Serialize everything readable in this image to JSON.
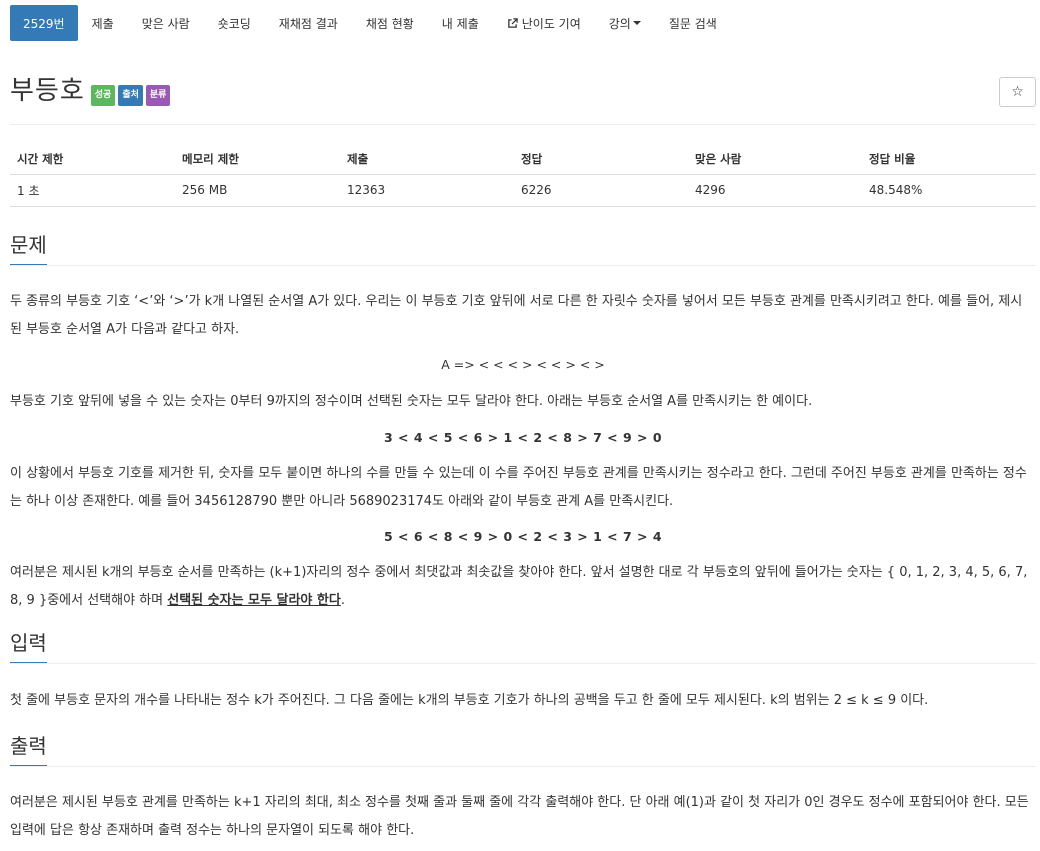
{
  "nav": {
    "items": [
      {
        "label": "2529번",
        "active": true
      },
      {
        "label": "제출"
      },
      {
        "label": "맞은 사람"
      },
      {
        "label": "숏코딩"
      },
      {
        "label": "재채점 결과"
      },
      {
        "label": "채점 현황"
      },
      {
        "label": "내 제출"
      },
      {
        "label": "난이도 기여",
        "icon": "external-link-icon"
      },
      {
        "label": "강의",
        "icon": "caret-down-icon"
      },
      {
        "label": "질문 검색"
      }
    ]
  },
  "problem": {
    "title": "부등호",
    "labels": [
      {
        "text": "성공",
        "color": "#5cb85c"
      },
      {
        "text": "출처",
        "color": "#337ab7"
      },
      {
        "text": "분류",
        "color": "#9b59b6"
      }
    ],
    "star_icon": "star-icon",
    "star_glyph": "☆"
  },
  "info": {
    "headers": [
      "시간 제한",
      "메모리 제한",
      "제출",
      "정답",
      "맞은 사람",
      "정답 비율"
    ],
    "values": [
      "1 초",
      "256 MB",
      "12363",
      "6226",
      "4296",
      "48.548%"
    ]
  },
  "sections": {
    "problem_title": "문제",
    "input_title": "입력",
    "output_title": "출력"
  },
  "body": {
    "p1": "두 종류의 부등호 기호 ‘<’와 ‘>’가 k개 나열된 순서열  A가 있다. 우리는 이 부등호 기호 앞뒤에 서로 다른 한 자릿수 숫자를 넣어서 모든 부등호 관계를 만족시키려고 한다. 예를 들어, 제시된 부등호 순서열 A가 다음과 같다고 하자.",
    "seq": "A =>  < < < > < < > < >",
    "p2": "부등호 기호 앞뒤에 넣을 수 있는 숫자는 0부터 9까지의 정수이며 선택된 숫자는 모두 달라야 한다. 아래는 부등호 순서열 A를 만족시키는 한 예이다.",
    "ex1": "3 < 4 < 5 < 6 > 1 < 2 < 8 > 7 < 9 > 0",
    "p3": "이 상황에서 부등호 기호를 제거한 뒤, 숫자를 모두 붙이면 하나의 수를 만들 수 있는데 이 수를 주어진 부등호 관계를 만족시키는 정수라고 한다. 그런데 주어진 부등호 관계를 만족하는 정수는 하나 이상 존재한다. 예를 들어 3456128790 뿐만 아니라 5689023174도 아래와 같이 부등호 관계 A를 만족시킨다.",
    "ex2": "5 < 6 < 8 < 9 > 0 < 2 < 3 > 1 < 7 > 4",
    "p4_a": "여러분은 제시된 k개의 부등호 순서를 만족하는 (k+1)자리의 정수 중에서 최댓값과 최솟값을 찾아야 한다. 앞서 설명한 대로 각 부등호의 앞뒤에 들어가는 숫자는 { 0, 1, 2, 3, 4, 5, 6, 7, 8, 9 }중에서 선택해야 하며 ",
    "p4_emph": "선택된 숫자는 모두 달라야 한다",
    "p4_b": ".",
    "input": "첫 줄에 부등호 문자의 개수를 나타내는 정수 k가 주어진다. 그 다음 줄에는 k개의 부등호 기호가 하나의 공백을 두고 한 줄에 모두 제시된다. k의 범위는 2 ≤ k ≤ 9 이다.",
    "output": "여러분은 제시된 부등호 관계를 만족하는 k+1 자리의 최대, 최소 정수를 첫째 줄과 둘째 줄에 각각 출력해야 한다. 단 아래 예(1)과 같이 첫 자리가 0인 경우도 정수에 포함되어야 한다. 모든 입력에 답은 항상 존재하며 출력 정수는 하나의 문자열이 되도록 해야 한다."
  }
}
